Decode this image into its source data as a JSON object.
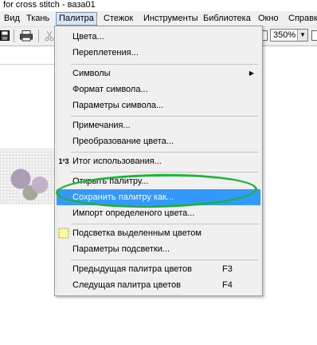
{
  "window": {
    "title": "for cross stitch - ваза01"
  },
  "menubar": {
    "items": [
      {
        "label": "Вид"
      },
      {
        "label": "Ткань"
      },
      {
        "label": "Палитра"
      },
      {
        "label": "Стежок"
      },
      {
        "label": "Инструменты"
      },
      {
        "label": "Библиотека"
      },
      {
        "label": "Окно"
      },
      {
        "label": "Справк"
      }
    ]
  },
  "toolbar": {
    "zoom_value": "350%",
    "icons": [
      "save-icon",
      "print-icon",
      "cut-icon"
    ]
  },
  "menu": {
    "items": [
      {
        "label": "Цвета...",
        "icon": null,
        "shortcut": "",
        "has_submenu": false
      },
      {
        "label": "Переплетения...",
        "icon": null,
        "shortcut": "",
        "has_submenu": false
      },
      {
        "label": "Символы",
        "icon": null,
        "shortcut": "",
        "has_submenu": true
      },
      {
        "label": "Формат символа...",
        "icon": null,
        "shortcut": "",
        "has_submenu": false
      },
      {
        "label": "Параметры символа...",
        "icon": null,
        "shortcut": "",
        "has_submenu": false
      },
      {
        "label": "Примечания...",
        "icon": null,
        "shortcut": "",
        "has_submenu": false
      },
      {
        "label": "Преобразование цвета...",
        "icon": null,
        "shortcut": "",
        "has_submenu": false
      },
      {
        "label": "Итог использования...",
        "icon": "usage-summary-icon",
        "icon_glyph": "1²3",
        "shortcut": "",
        "has_submenu": false
      },
      {
        "label": "Открыть палитру...",
        "icon": null,
        "shortcut": "",
        "has_submenu": false
      },
      {
        "label": "Сохранить палитру как...",
        "icon": null,
        "shortcut": "",
        "has_submenu": false,
        "highlighted": true
      },
      {
        "label": "Импорт определеного цвета...",
        "icon": null,
        "shortcut": "",
        "has_submenu": false
      },
      {
        "label": "Подсветка выделенным цветом",
        "icon": "highlight-color-icon",
        "shortcut": "",
        "has_submenu": false
      },
      {
        "label": "Параметры подсветки...",
        "icon": null,
        "shortcut": "",
        "has_submenu": false
      },
      {
        "label": "Предыдущая палитра цветов",
        "icon": null,
        "shortcut": "F3",
        "has_submenu": false
      },
      {
        "label": "Следущая палитра цветов",
        "icon": null,
        "shortcut": "F4",
        "has_submenu": false
      }
    ]
  },
  "colors": {
    "highlight": "#3399ff",
    "menu_bg": "#f0f0f0",
    "annotation": "#1db33b"
  }
}
